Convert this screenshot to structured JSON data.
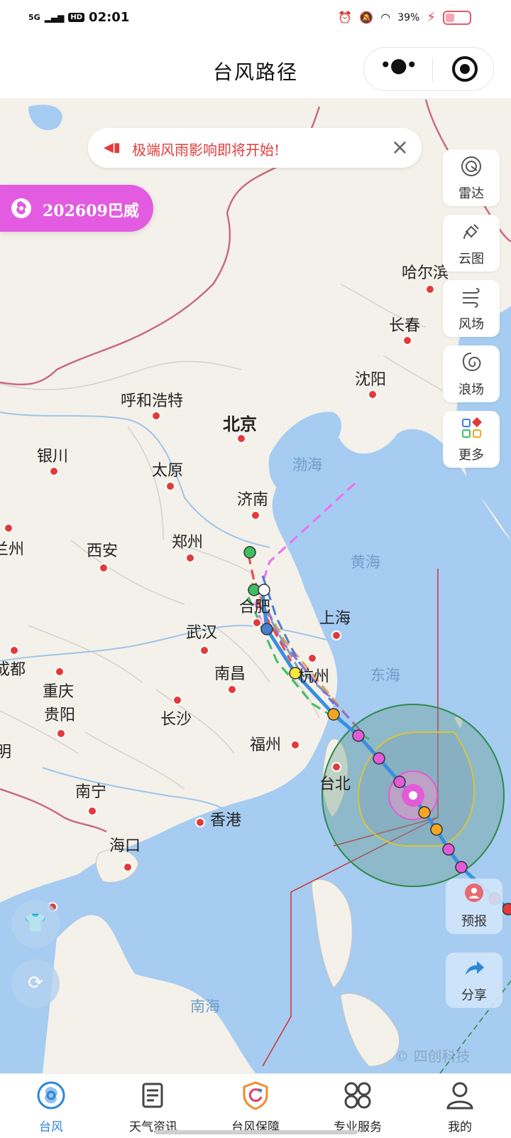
{
  "status_bar": {
    "network": "5G",
    "hd": "HD",
    "time": "02:01",
    "battery": "39%",
    "battery_level": 0.39
  },
  "header": {
    "title": "台风路径",
    "more_icon": "more-dots-icon",
    "target_icon": "target-icon"
  },
  "alert": {
    "text": "极端风雨影响即将开始!",
    "icon": "horn-icon",
    "close_icon": "close-icon",
    "color": "#e23c3c"
  },
  "typhoon": {
    "label": "202609巴威",
    "color": "#e25be0"
  },
  "tools": [
    {
      "label": "雷达",
      "icon": "radar-icon"
    },
    {
      "label": "云图",
      "icon": "satellite-icon"
    },
    {
      "label": "风场",
      "icon": "wind-icon"
    },
    {
      "label": "浪场",
      "icon": "wave-icon"
    },
    {
      "label": "更多",
      "icon": "grid-icon"
    }
  ],
  "cities": [
    "哈尔滨",
    "长春",
    "沈阳",
    "呼和浩特",
    "北京",
    "银川",
    "太原",
    "济南",
    "兰州",
    "西安",
    "郑州",
    "合肥",
    "上海",
    "武汉",
    "杭州",
    "成都",
    "重庆",
    "南昌",
    "长沙",
    "贵阳",
    "福州",
    "台北",
    "南宁",
    "香港",
    "海口",
    "明"
  ],
  "seas": [
    "渤海",
    "黄海",
    "东海",
    "南海"
  ],
  "map_buttons": {
    "forecast_label": "预报",
    "share_label": "分享",
    "shirt_icon": "shirt-icon",
    "refresh_icon": "refresh-icon",
    "forecast_icon": "person-icon",
    "share_icon": "share-icon"
  },
  "copyright": "© 四创科技",
  "tabs": [
    {
      "label": "台风",
      "icon": "typhoon-icon",
      "active": true
    },
    {
      "label": "天气资讯",
      "icon": "news-icon",
      "active": false
    },
    {
      "label": "台风保障",
      "icon": "shield-icon",
      "active": false
    },
    {
      "label": "专业服务",
      "icon": "clover-icon",
      "active": false
    },
    {
      "label": "我的",
      "icon": "user-icon",
      "active": false
    }
  ],
  "colors": {
    "accent": "#2d86d9",
    "sea": "#a6ccf2",
    "land": "#f4f1ea",
    "border": "#c86c7d",
    "track": "#4a9ad8"
  }
}
